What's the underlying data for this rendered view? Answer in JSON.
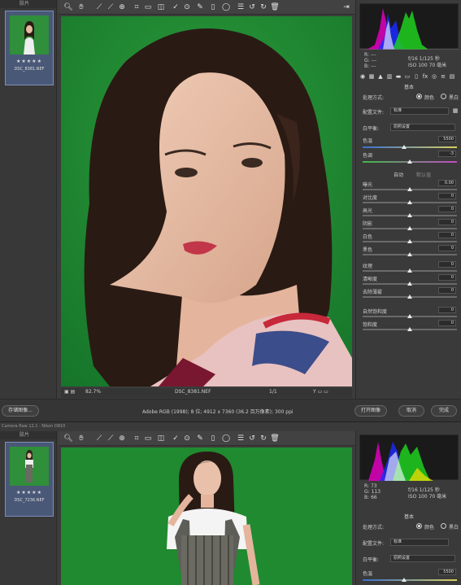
{
  "top": {
    "filmstrip": {
      "header": "胶片",
      "file_name": "DSC_8381.NEF",
      "stars": "★★★★★"
    },
    "status": {
      "zoom": "82.7%",
      "file_name": "DSC_8381.NEF",
      "page": "1/1"
    },
    "bottom_bar": {
      "save_label": "存储图像...",
      "info": "Adobe RGB (1998); 8 位; 4912 x 7360 (36.2 百万像素); 300 ppi",
      "open_label": "打开图像",
      "cancel_label": "取消",
      "done_label": "完成"
    },
    "panel": {
      "readout": {
        "r": "R:",
        "g": "G:",
        "b": "B:",
        "rv": "---",
        "gv": "---",
        "bv": "---",
        "exposure": "f/16  1/125 秒",
        "iso": "ISO 100  70 毫米"
      },
      "section_basic": "基本",
      "treatment_label": "处理方式:",
      "treatment_color": "颜色",
      "treatment_bw": "黑白",
      "profile_label": "配置文件:",
      "profile_value": "标准",
      "wb_label": "白平衡:",
      "wb_value": "原照设置",
      "sliders": [
        {
          "label": "色温",
          "value": "5500"
        },
        {
          "label": "色调",
          "value": "-3"
        }
      ],
      "auto_label": "自动",
      "default_label": "默认值",
      "tone": [
        {
          "label": "曝光",
          "value": "0.00"
        },
        {
          "label": "对比度",
          "value": "0"
        },
        {
          "label": "高光",
          "value": "0"
        },
        {
          "label": "阴影",
          "value": "0"
        },
        {
          "label": "白色",
          "value": "0"
        },
        {
          "label": "黑色",
          "value": "0"
        }
      ],
      "presence": [
        {
          "label": "纹理",
          "value": "0"
        },
        {
          "label": "清晰度",
          "value": "0"
        },
        {
          "label": "去除薄雾",
          "value": "0"
        }
      ],
      "sat": [
        {
          "label": "自然饱和度",
          "value": "0"
        },
        {
          "label": "饱和度",
          "value": "0"
        }
      ]
    }
  },
  "divider": {
    "left_text": "Camera Raw 12.1 · Nikon D810"
  },
  "bottom": {
    "filmstrip": {
      "header": "胶片",
      "file_name": "DSC_7236.NEF",
      "stars": "★★★★★"
    },
    "panel": {
      "readout": {
        "r": "R:",
        "g": "G:",
        "b": "B:",
        "rv": "73",
        "gv": "113",
        "bv": "66",
        "exposure": "f/16  1/125 秒",
        "iso": "ISO 100  70 毫米"
      },
      "section_basic": "基本",
      "treatment_label": "处理方式:",
      "treatment_color": "颜色",
      "treatment_bw": "黑白",
      "profile_label": "配置文件:",
      "profile_value": "标准",
      "wb_label": "白平衡:",
      "wb_value": "原照设置",
      "temp_label": "色温",
      "temp_value": "5500"
    }
  },
  "colors": {
    "green_screen": "#1f8a2f",
    "panel_bg": "#3a3a3a",
    "thumb_selected": "#4a5878"
  },
  "icons": [
    "zoom-icon",
    "hand-icon",
    "white-balance-icon",
    "color-sampler-icon",
    "target-adjust-icon",
    "crop-icon",
    "straighten-icon",
    "transform-icon",
    "spot-removal-icon",
    "red-eye-icon",
    "brush-icon",
    "graduated-filter-icon",
    "radial-filter-icon",
    "preferences-icon",
    "rotate-left-icon",
    "rotate-right-icon",
    "trash-icon"
  ]
}
